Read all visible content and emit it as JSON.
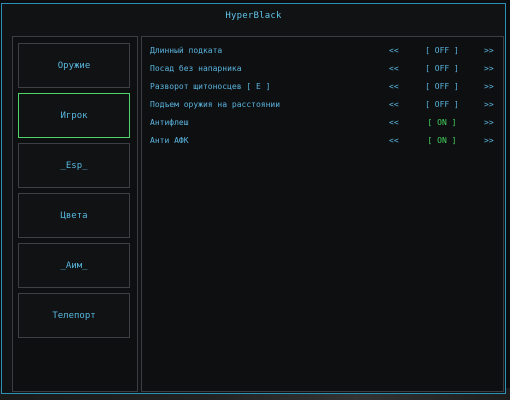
{
  "window": {
    "title": "HyperBlack"
  },
  "sidebar": {
    "tabs": [
      {
        "label": "Оружие",
        "active": false
      },
      {
        "label": "Игрок",
        "active": true
      },
      {
        "label": "_Esp_",
        "active": false
      },
      {
        "label": "Цвета",
        "active": false
      },
      {
        "label": "_Aим_",
        "active": false
      },
      {
        "label": "Телепорт",
        "active": false
      }
    ]
  },
  "options": [
    {
      "label": "Длинный подката",
      "value": "[ OFF ]",
      "state": "off"
    },
    {
      "label": "Посад без напарника",
      "value": "[ OFF ]",
      "state": "off"
    },
    {
      "label": "Разворот щитоносцев [ E ]",
      "value": "[ OFF ]",
      "state": "off"
    },
    {
      "label": "Подъем оружия на расстоянии",
      "value": "[ OFF ]",
      "state": "off"
    },
    {
      "label": "Антифлеш",
      "value": "[ ON ]",
      "state": "on"
    },
    {
      "label": "Анти АФК",
      "value": "[ ON ]",
      "state": "on"
    }
  ],
  "controls": {
    "prev": "<<",
    "next": ">>"
  },
  "colors": {
    "accent": "#58b8e0",
    "on": "#44d460",
    "border": "#2c8fb8",
    "active_tab": "#4fd36a"
  }
}
